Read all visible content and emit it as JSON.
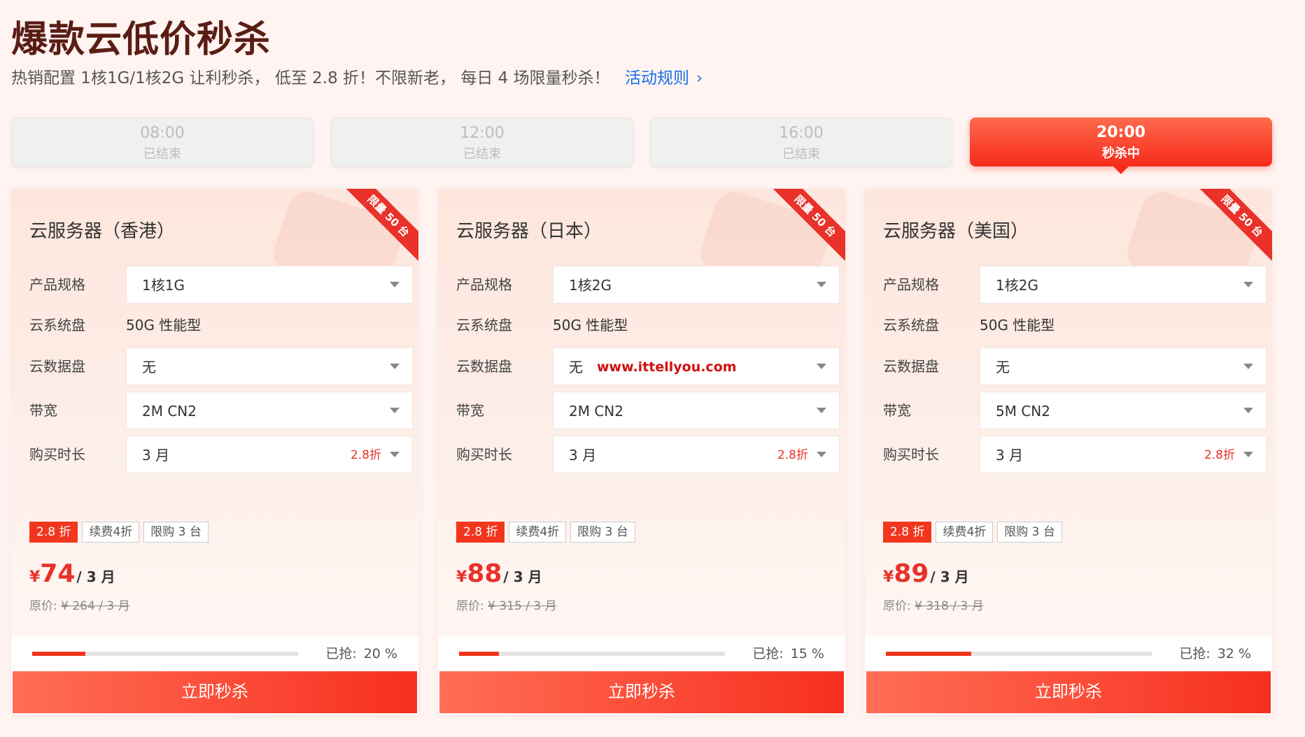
{
  "header": {
    "title": "爆款云低价秒杀",
    "subtitle": "热销配置 1核1G/1核2G 让利秒杀， 低至 2.8 折！不限新老， 每日 4 场限量秒杀！",
    "rules_link": "活动规则",
    "rules_icon": "chevron-right-icon"
  },
  "slots": [
    {
      "time": "08:00",
      "status": "已结束"
    },
    {
      "time": "12:00",
      "status": "已结束"
    },
    {
      "time": "16:00",
      "status": "已结束"
    },
    {
      "time": "20:00",
      "status": "秒杀中"
    }
  ],
  "labels": {
    "spec": "产品规格",
    "system_disk": "云系统盘",
    "data_disk": "云数据盘",
    "bandwidth": "带宽",
    "duration": "购买时长",
    "grabbed": "已抢:",
    "buy": "立即秒杀",
    "ribbon": "限量 50 台",
    "orig_prefix": "原价:"
  },
  "cards": [
    {
      "name": "云服务器（香港）",
      "spec": "1核1G",
      "system_disk": "50G 性能型",
      "data_disk": "无",
      "bandwidth": "2M CN2",
      "duration": "3 月",
      "duration_discount": "2.8折",
      "tags": [
        "2.8 折",
        "续费4折",
        "限购 3 台"
      ],
      "yen": "¥",
      "price": "74",
      "per": "/ 3 月",
      "orig": "¥ 264 / 3 月",
      "progress_label": "20 %",
      "progress": 0.2
    },
    {
      "name": "云服务器（日本）",
      "spec": "1核2G",
      "system_disk": "50G 性能型",
      "data_disk": "无",
      "watermark": "www.ittellyou.com",
      "bandwidth": "2M CN2",
      "duration": "3 月",
      "duration_discount": "2.8折",
      "tags": [
        "2.8 折",
        "续费4折",
        "限购 3 台"
      ],
      "yen": "¥",
      "price": "88",
      "per": "/ 3 月",
      "orig": "¥ 315 / 3 月",
      "progress_label": "15 %",
      "progress": 0.15
    },
    {
      "name": "云服务器（美国）",
      "spec": "1核2G",
      "system_disk": "50G 性能型",
      "data_disk": "无",
      "bandwidth": "5M CN2",
      "duration": "3 月",
      "duration_discount": "2.8折",
      "tags": [
        "2.8 折",
        "续费4折",
        "限购 3 台"
      ],
      "yen": "¥",
      "price": "89",
      "per": "/ 3 月",
      "orig": "¥ 318 / 3 月",
      "progress_label": "32 %",
      "progress": 0.32
    }
  ],
  "colors": {
    "accent": "#f2361e",
    "title": "#5a1d14",
    "link": "#1a6ee6"
  }
}
